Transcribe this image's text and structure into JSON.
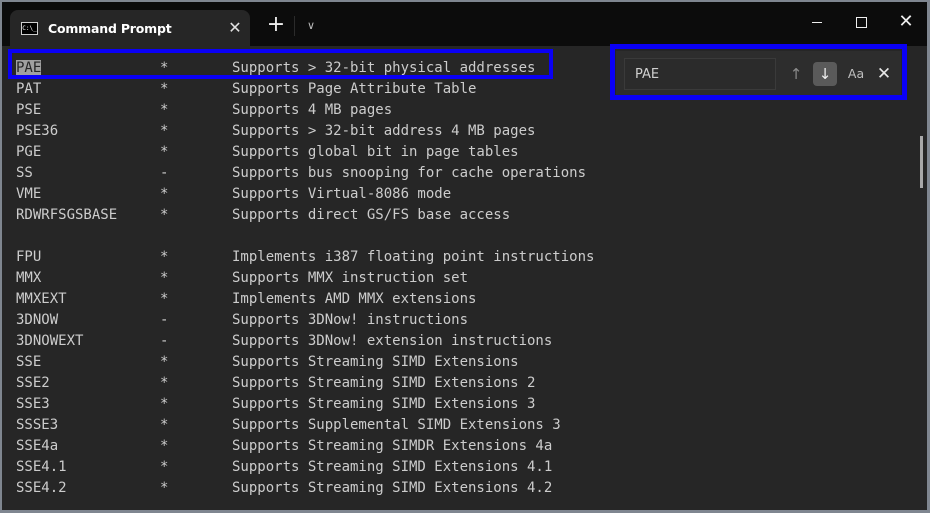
{
  "window": {
    "tab_title": "Command Prompt",
    "tab_icon": "cmd-icon",
    "new_tab_label": "+",
    "dropdown_label": "⌄",
    "close_tab_label": "✕",
    "close_label": "✕"
  },
  "find": {
    "query": "PAE",
    "up_label": "↑",
    "down_label": "↓",
    "case_label": "Aa",
    "close_label": "✕"
  },
  "terminal": {
    "lines": [
      {
        "name": "PAE",
        "flag": "*",
        "desc": "Supports > 32-bit physical addresses"
      },
      {
        "name": "PAT",
        "flag": "*",
        "desc": "Supports Page Attribute Table"
      },
      {
        "name": "PSE",
        "flag": "*",
        "desc": "Supports 4 MB pages"
      },
      {
        "name": "PSE36",
        "flag": "*",
        "desc": "Supports > 32-bit address 4 MB pages"
      },
      {
        "name": "PGE",
        "flag": "*",
        "desc": "Supports global bit in page tables"
      },
      {
        "name": "SS",
        "flag": "-",
        "desc": "Supports bus snooping for cache operations"
      },
      {
        "name": "VME",
        "flag": "*",
        "desc": "Supports Virtual-8086 mode"
      },
      {
        "name": "RDWRFSGSBASE",
        "flag": "*",
        "desc": "Supports direct GS/FS base access"
      },
      {
        "name": "",
        "flag": "",
        "desc": ""
      },
      {
        "name": "FPU",
        "flag": "*",
        "desc": "Implements i387 floating point instructions"
      },
      {
        "name": "MMX",
        "flag": "*",
        "desc": "Supports MMX instruction set"
      },
      {
        "name": "MMXEXT",
        "flag": "*",
        "desc": "Implements AMD MMX extensions"
      },
      {
        "name": "3DNOW",
        "flag": "-",
        "desc": "Supports 3DNow! instructions"
      },
      {
        "name": "3DNOWEXT",
        "flag": "-",
        "desc": "Supports 3DNow! extension instructions"
      },
      {
        "name": "SSE",
        "flag": "*",
        "desc": "Supports Streaming SIMD Extensions"
      },
      {
        "name": "SSE2",
        "flag": "*",
        "desc": "Supports Streaming SIMD Extensions 2"
      },
      {
        "name": "SSE3",
        "flag": "*",
        "desc": "Supports Streaming SIMD Extensions 3"
      },
      {
        "name": "SSSE3",
        "flag": "*",
        "desc": "Supports Supplemental SIMD Extensions 3"
      },
      {
        "name": "SSE4a",
        "flag": "*",
        "desc": "Supports Streaming SIMDR Extensions 4a"
      },
      {
        "name": "SSE4.1",
        "flag": "*",
        "desc": "Supports Streaming SIMD Extensions 4.1"
      },
      {
        "name": "SSE4.2",
        "flag": "*",
        "desc": "Supports Streaming SIMD Extensions 4.2"
      }
    ]
  },
  "colors": {
    "annotation": "#0a00f5",
    "terminal_bg": "#262626",
    "text": "#cccccc",
    "highlight": "#a0a0a0"
  }
}
